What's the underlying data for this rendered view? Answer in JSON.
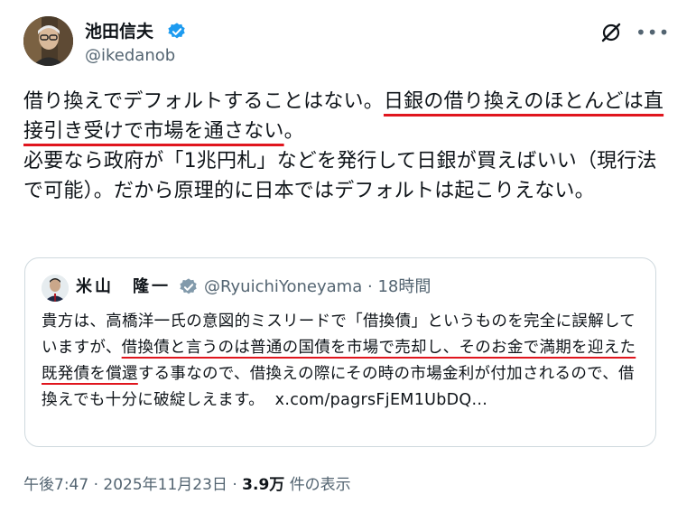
{
  "author": {
    "name": "池田信夫",
    "handle": "@ikedanob"
  },
  "tweet": {
    "part1": "借り換えでデフォルトすることはない。",
    "part2": "日銀の借り換えのほとんどは直接引き受けで市場を通さない",
    "part3": "。",
    "part4": "必要なら政府が「1兆円札」などを発行して日銀が買えばいい（現行法で可能）。だから原理的に日本ではデフォルトは起こりえない。"
  },
  "quote": {
    "name": "米山　隆一",
    "handle": "@RyuichiYoneyama",
    "separator": "·",
    "time": "18時間",
    "text1": "貴方は、高橋洋一氏の意図的ミスリードで「借換債」というものを完全に誤解していますが、",
    "text2": "借換債と言うのは普通の国債を市場で売却し、そのお金で満期を迎えた既発債を償還",
    "text3": "する事なので、借換えの際にその時の市場金利が付加されるので、借換えでも十分に破綻しえます。",
    "link": "x.com/pagrsFjEM1UbDQ..."
  },
  "footer": {
    "time": "午後7:47",
    "sep1": "·",
    "date": "2025年11月23日",
    "sep2": "·",
    "views": "3.9万",
    "views_label": "件の表示"
  },
  "colors": {
    "verified": "#1d9bf0",
    "q_verified": "#829aab",
    "underline": "#e0161e",
    "muted": "#536471"
  },
  "icons": {
    "verified": "verified-badge-icon",
    "grok": "grok-icon",
    "more": "more-icon"
  }
}
